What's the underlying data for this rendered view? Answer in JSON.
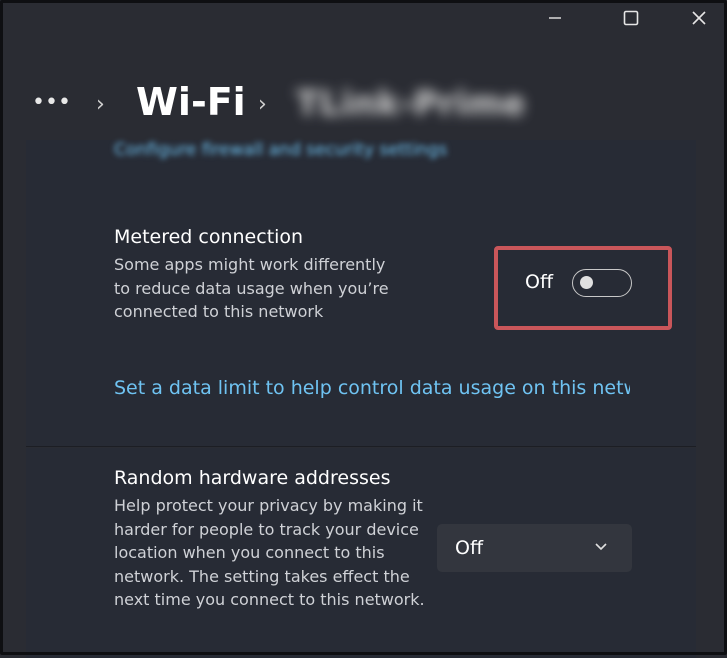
{
  "header": {
    "more_label": "•••",
    "chevron_1": "›",
    "title": "Wi-Fi",
    "chevron_2": "›",
    "network_name": "TLink-Prime"
  },
  "firewall_link": "Configure firewall and security settings",
  "metered": {
    "title": "Metered connection",
    "description": "Some apps might work differently to reduce data usage when you’re connected to this network",
    "toggle_label": "Off",
    "toggle_on": false,
    "data_limit_link": "Set a data limit to help control data usage on this netwo"
  },
  "random_hw": {
    "title": "Random hardware addresses",
    "description": "Help protect your privacy by making it harder for people to track your device location when you connect to this network. The setting takes effect the next time you connect to this network.",
    "dropdown_value": "Off"
  },
  "colors": {
    "accent_link": "#6fc3f2",
    "highlight": "#c9565a",
    "background": "#2a2c33"
  }
}
